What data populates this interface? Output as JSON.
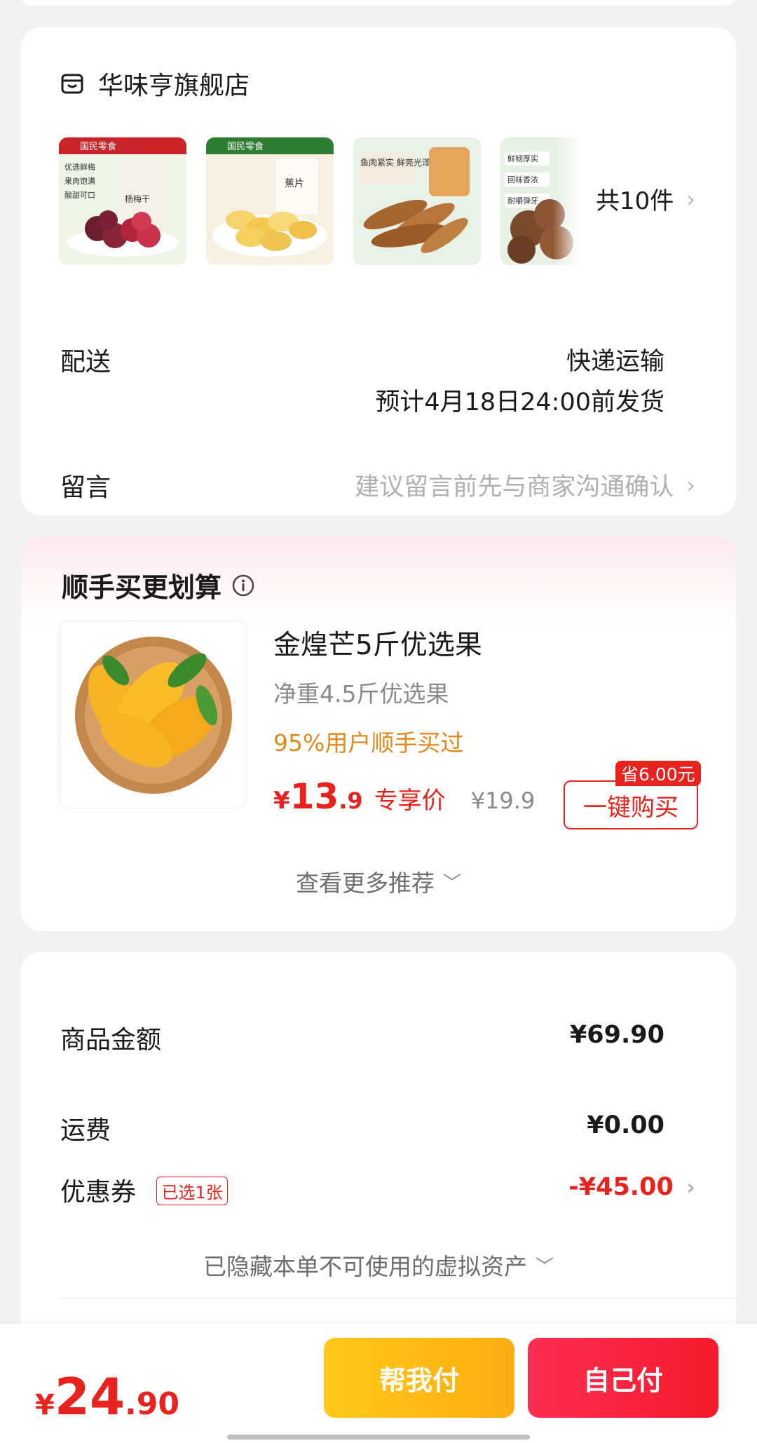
{
  "store": {
    "name": "华味亨旗舰店",
    "count_text": "共10件",
    "thumbs": [
      {
        "label": "杨梅干",
        "badge": "国民零食",
        "features": [
          "优选鲜梅",
          "果肉饱满",
          "酸甜可口"
        ]
      },
      {
        "label": "蕉片",
        "badge": "国民零食"
      },
      {
        "label": "鱼肉紧实 鲜亮光泽"
      },
      {
        "features": [
          "鲜韧厚实",
          "回味香浓",
          "耐嚼弹牙"
        ]
      }
    ],
    "delivery_label": "配送",
    "delivery_method": "快递运输",
    "delivery_date": "预计4月18日24:00前发货",
    "message_label": "留言",
    "message_placeholder": "建议留言前先与商家沟通确认"
  },
  "recommend": {
    "title": "顺手买更划算",
    "product": {
      "name": "金煌芒5斤优选果",
      "subtitle": "净重4.5斤优选果",
      "stat": "95%用户顺手买过",
      "price_symbol": "¥",
      "price_int": "13",
      "price_dec": ".9",
      "price_tag": "专享价",
      "original_price": "¥19.9",
      "save_badge": "省6.00元",
      "buy_label": "一键购买"
    },
    "more_label": "查看更多推荐"
  },
  "summary": {
    "goods_label": "商品金额",
    "goods_value": "¥69.90",
    "shipping_label": "运费",
    "shipping_value": "¥0.00",
    "coupon_label": "优惠券",
    "coupon_badge": "已选1张",
    "coupon_value": "-¥45.00",
    "hidden_note": "已隐藏本单不可使用的虚拟资产"
  },
  "bottom": {
    "total_symbol": "¥",
    "total_int": "24",
    "total_dec": ".90",
    "help_pay_label": "帮我付",
    "self_pay_label": "自己付"
  },
  "colors": {
    "accent_red": "#e8231f",
    "orange_text": "#e08a1e",
    "help_button": "#ffbb16",
    "self_button": "#f8223d"
  }
}
